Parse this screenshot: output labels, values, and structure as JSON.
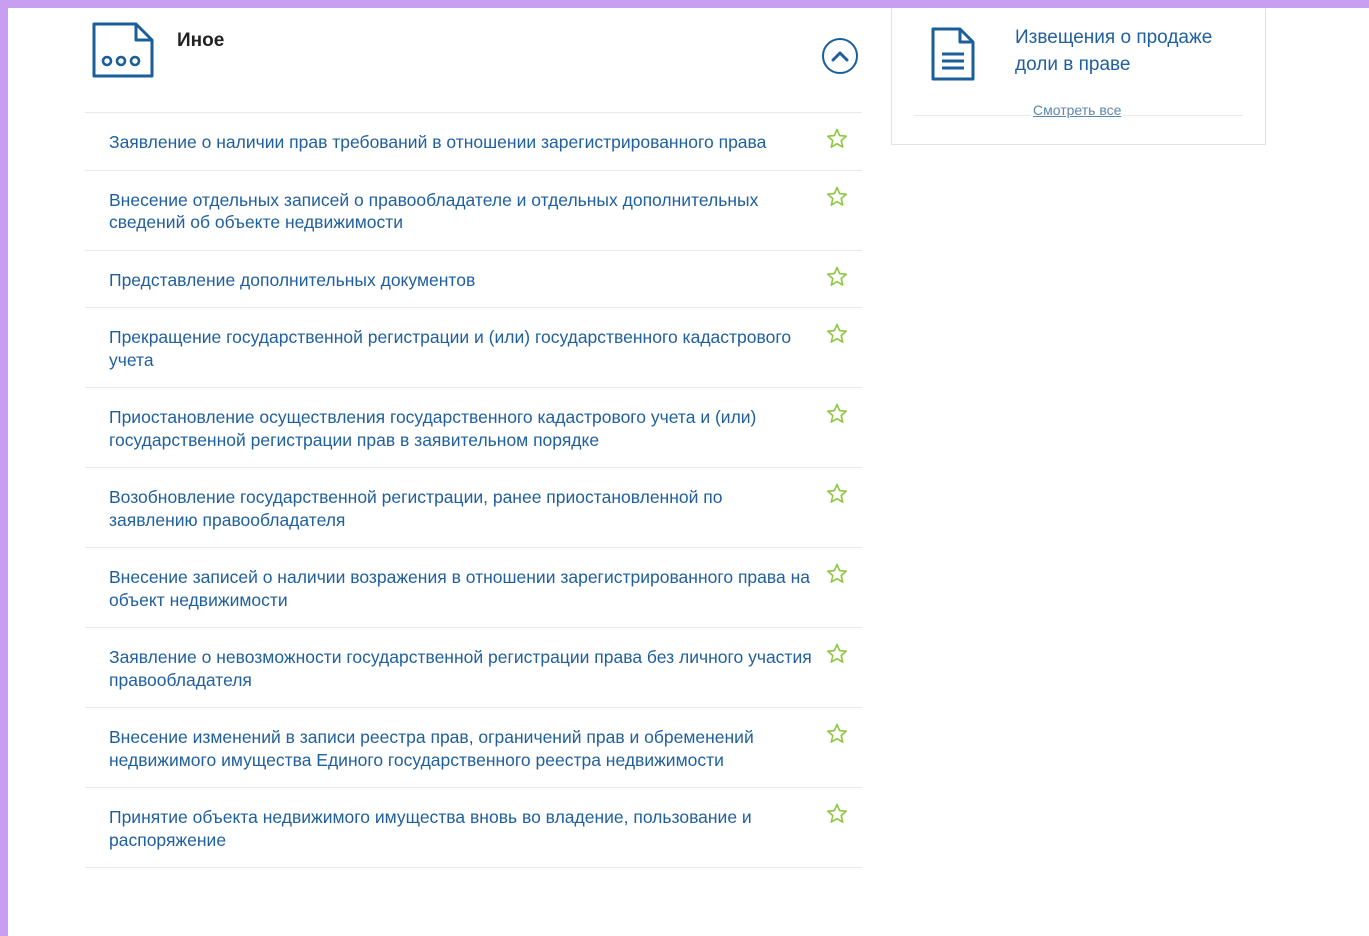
{
  "section": {
    "title": "Иное",
    "icon": "document-ellipsis-icon",
    "collapse_icon": "chevron-up-icon"
  },
  "items": [
    {
      "label": "Заявление о наличии прав требований в отношении зарегистрированного права"
    },
    {
      "label": "Внесение отдельных записей о правообладателе и отдельных дополнительных сведений об объекте недвижимости"
    },
    {
      "label": "Представление дополнительных документов"
    },
    {
      "label": "Прекращение государственной регистрации и (или) государственного кадастрового учета"
    },
    {
      "label": "Приостановление осуществления государственного кадастрового учета и (или) государственной регистрации прав в заявительном порядке"
    },
    {
      "label": "Возобновление государственной регистрации, ранее приостановленной по заявлению правообладателя"
    },
    {
      "label": "Внесение записей о наличии возражения в отношении зарегистрированного права на объект недвижимости"
    },
    {
      "label": "Заявление о невозможности государственной регистрации права без личного участия правообладателя"
    },
    {
      "label": "Внесение изменений в записи реестра прав, ограничений прав и обременений недвижимого имущества Единого государственного реестра недвижимости"
    },
    {
      "label": "Принятие объекта недвижимого имущества вновь во владение, пользование и распоряжение"
    }
  ],
  "card": {
    "title": "Извещения о продаже доли в праве",
    "view_all": "Смотреть все",
    "icon": "document-lines-icon"
  },
  "colors": {
    "link": "#1f5f9e",
    "accent": "#1a5e9a",
    "star": "#8cc63f",
    "border": "#e6e9ed",
    "page_frame": "#c89ff0"
  }
}
